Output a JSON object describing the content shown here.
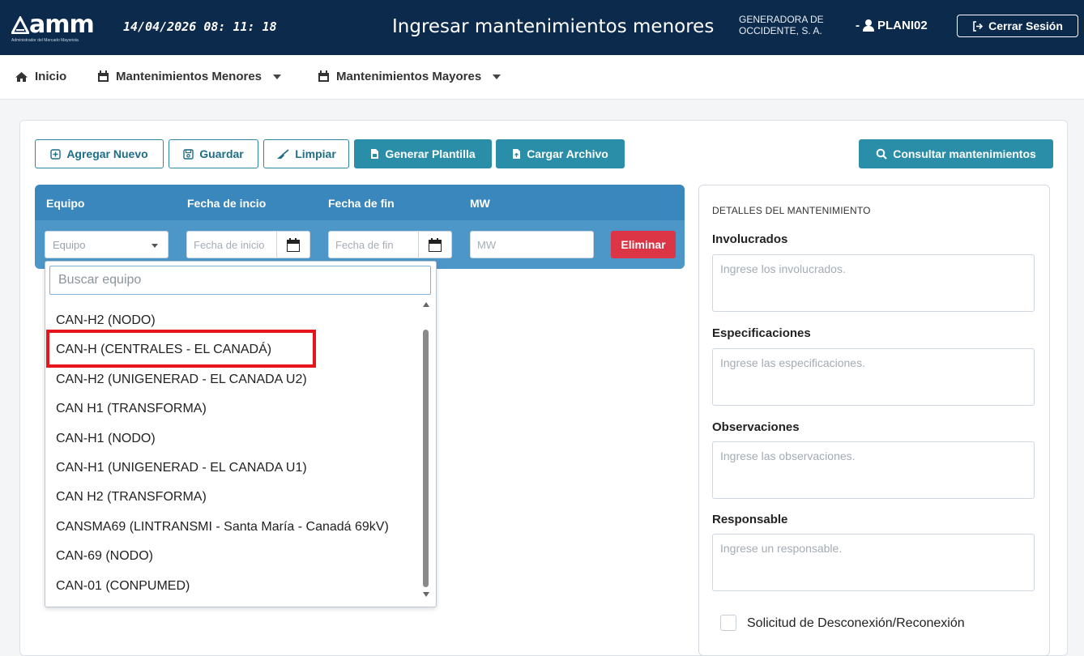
{
  "header": {
    "logo_text": "amm",
    "logo_subtitle": "Administrador del Mercado Mayorista",
    "datetime": "14/04/2026  08: 11: 18",
    "title": "Ingresar mantenimientos menores",
    "company_line1": "GENERADORA DE",
    "company_line2": "OCCIDENTE, S. A.",
    "user_prefix": "-",
    "user": "PLANI02",
    "logout_label": "Cerrar Sesión"
  },
  "nav": {
    "items": [
      {
        "label": "Inicio"
      },
      {
        "label": "Mantenimientos Menores"
      },
      {
        "label": "Mantenimientos Mayores"
      }
    ]
  },
  "toolbar": {
    "add_label": "Agregar Nuevo",
    "save_label": "Guardar",
    "clear_label": "Limpiar",
    "template_label": "Generar Plantilla",
    "upload_label": "Cargar Archivo",
    "query_label": "Consultar mantenimientos"
  },
  "table": {
    "headers": [
      "Equipo",
      "Fecha de incio",
      "Fecha de fin",
      "MW"
    ],
    "equipo_value": "Equipo",
    "start_placeholder": "Fecha de inicio",
    "end_placeholder": "Fecha de fin",
    "mw_placeholder": "MW",
    "delete_label": "Eliminar"
  },
  "dropdown": {
    "search_placeholder": "Buscar equipo",
    "items": [
      "CAN-H2 (NODO)",
      "CAN-H (CENTRALES - EL CANADÁ)",
      "CAN-H2 (UNIGENERAD - EL CANADA U2)",
      "CAN H1 (TRANSFORMA)",
      "CAN-H1 (NODO)",
      "CAN-H1 (UNIGENERAD - EL CANADA U1)",
      "CAN H2 (TRANSFORMA)",
      "CANSMA69 (LINTRANSMI - Santa María - Canadá 69kV)",
      "CAN-69 (NODO)",
      "CAN-01 (CONPUMED)"
    ],
    "highlighted_index": 1,
    "highlight_color": "#e8141c"
  },
  "details": {
    "title": "DETALLES DEL MANTENIMIENTO",
    "involucrados_label": "Involucrados",
    "involucrados_placeholder": "Ingrese los involucrados.",
    "especificaciones_label": "Especificaciones",
    "especificaciones_placeholder": "Ingrese las especificaciones.",
    "observaciones_label": "Observaciones",
    "observaciones_placeholder": "Ingrese las observaciones.",
    "responsable_label": "Responsable",
    "responsable_placeholder": "Ingrese un responsable.",
    "checkbox_label": "Solicitud de Desconexión/Reconexión"
  },
  "colors": {
    "header_bg": "#0c2a4c",
    "accent": "#2a8ea8",
    "table_header": "#3a87bd",
    "danger": "#dc3545"
  }
}
